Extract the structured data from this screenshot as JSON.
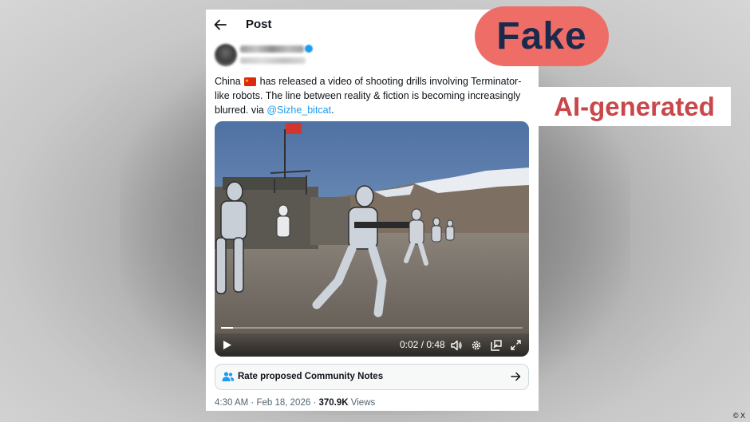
{
  "post_header": {
    "title": "Post"
  },
  "tweet": {
    "text_before_flag": "China",
    "flag": "china-flag-icon",
    "text_after_flag": " has released a video of shooting drills involving Terminator-like robots. The line between reality & fiction is becoming increasingly blurred. via ",
    "mention": "@Sizhe_bitcat",
    "text_end": "."
  },
  "video": {
    "time": "0:02 / 0:48",
    "progress_fraction": 0.04
  },
  "community_notes": {
    "label": "Rate proposed Community Notes"
  },
  "meta": {
    "time": "4:30 AM",
    "separator": "·",
    "date": "Feb 18, 2026",
    "views_count": "370.9K",
    "views_label": "Views"
  },
  "overlay": {
    "fake_label": "Fake",
    "ai_label": "AI-generated",
    "credit": "© X"
  },
  "colors": {
    "fake_badge": "#ee6e67",
    "fake_text": "#1b2a4c",
    "ai_text": "#c9474a",
    "link": "#1d9bf0"
  }
}
